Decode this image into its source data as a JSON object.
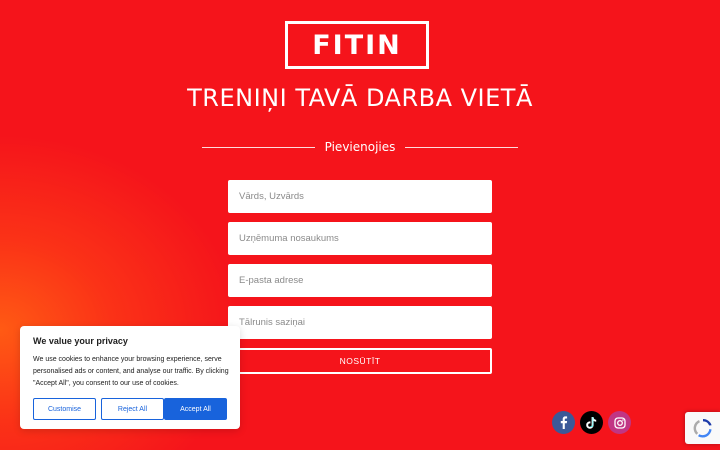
{
  "brand": {
    "logo_text": "FITIN"
  },
  "hero": {
    "headline": "TRENIŅI TAVĀ DARBA VIETĀ",
    "join_label": "Pievienojies"
  },
  "form": {
    "name_placeholder": "Vārds, Uzvārds",
    "company_placeholder": "Uzņēmuma nosaukums",
    "email_placeholder": "E-pasta adrese",
    "phone_placeholder": "Tālrunis saziņai",
    "submit_label": "NOSŪTĪT"
  },
  "cookie_banner": {
    "title": "We value your privacy",
    "body": "We use cookies to enhance your browsing experience, serve personalised ads or content, and analyse our traffic. By clicking \"Accept All\", you consent to our use of cookies.",
    "customise_label": "Customise",
    "reject_label": "Reject All",
    "accept_label": "Accept All"
  },
  "social": [
    {
      "name": "facebook",
      "icon": "facebook-icon",
      "color": "#3b5998"
    },
    {
      "name": "tiktok",
      "icon": "tiktok-icon",
      "color": "#000000"
    },
    {
      "name": "instagram",
      "icon": "instagram-icon",
      "color": "#c13584"
    }
  ],
  "colors": {
    "background": "#f5141b",
    "accent_orange": "#ff5a14",
    "cookie_blue": "#1863dc"
  }
}
